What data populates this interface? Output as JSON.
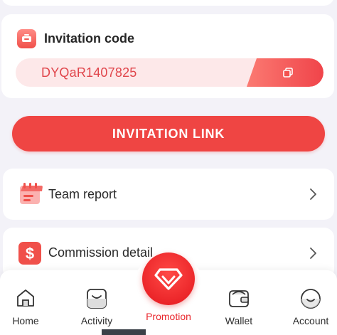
{
  "invite": {
    "title": "Invitation code",
    "code": "DYQaR1407825",
    "link_button": "INVITATION LINK"
  },
  "menu": [
    {
      "label": "Team report",
      "icon": "calendar-icon"
    },
    {
      "label": "Commission detail",
      "icon": "dollar-icon"
    }
  ],
  "nav": {
    "home": "Home",
    "activity": "Activity",
    "promotion": "Promotion",
    "wallet": "Wallet",
    "account": "Account"
  },
  "colors": {
    "accent": "#ef4543",
    "code_text": "#e0454b",
    "code_pill_bg": "#fde8e9",
    "page_bg": "#f3f2f8",
    "active_nav": "#e9262c"
  }
}
